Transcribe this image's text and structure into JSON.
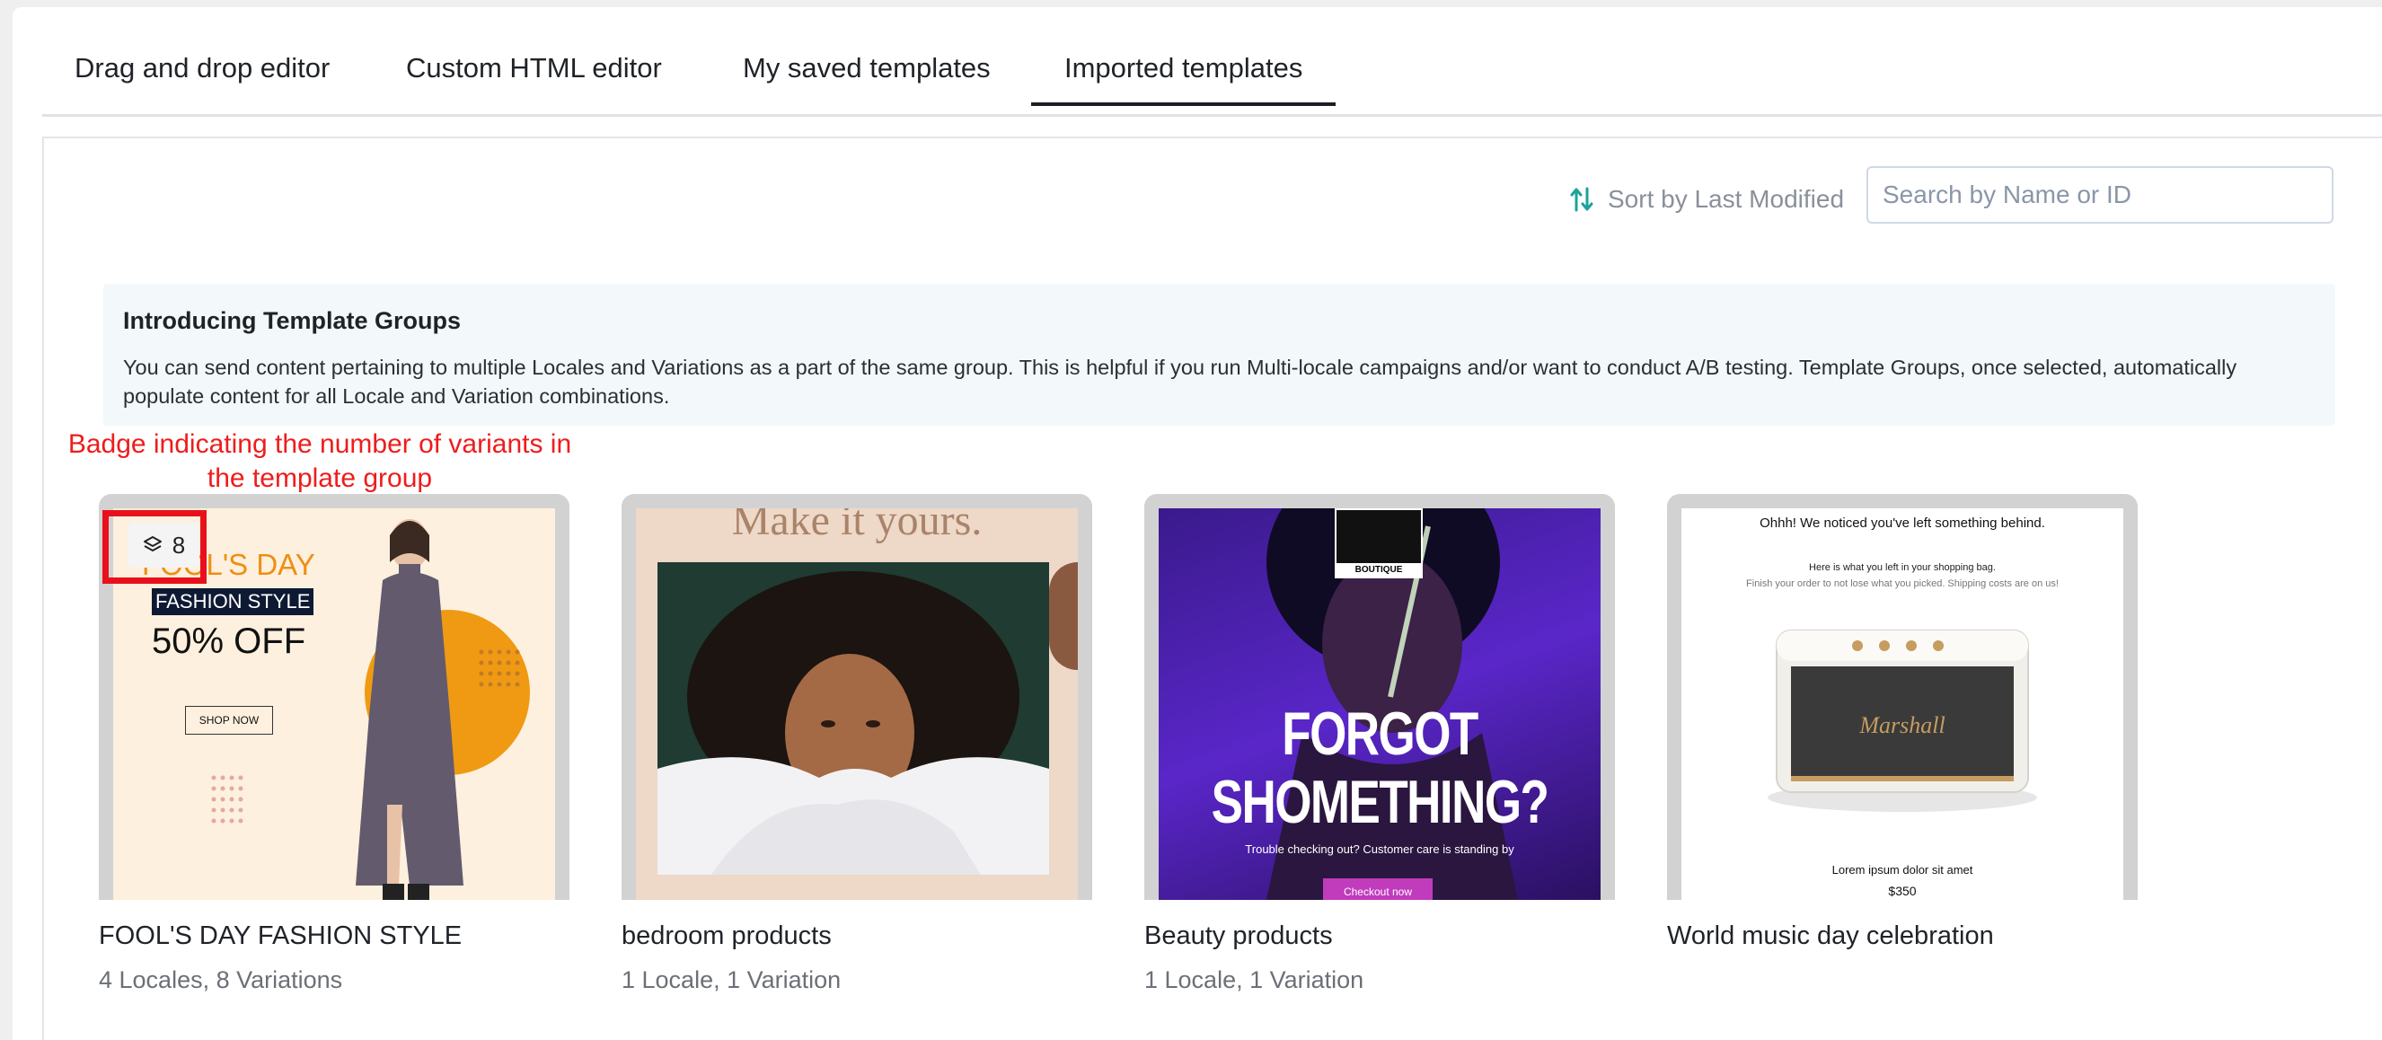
{
  "tabs": [
    {
      "label": "Drag and drop editor",
      "active": false
    },
    {
      "label": "Custom HTML editor",
      "active": false
    },
    {
      "label": "My saved templates",
      "active": false
    },
    {
      "label": "Imported templates",
      "active": true
    }
  ],
  "toolbar": {
    "sort_label": "Sort by Last Modified",
    "search_placeholder": "Search by Name or ID",
    "search_value": ""
  },
  "info_banner": {
    "title": "Introducing Template Groups",
    "body": "You can send content pertaining to multiple Locales and Variations as a part of the same group. This is helpful if you run Multi-locale campaigns and/or want to conduct A/B testing. Template Groups, once selected, automatically populate content for all Locale and Variation combinations."
  },
  "annotation": {
    "text_line1": "Badge indicating the number of variants in",
    "text_line2": "the template group",
    "color": "#ee1c1c"
  },
  "templates": [
    {
      "name": "FOOL'S DAY FASHION STYLE",
      "meta": "4 Locales, 8 Variations",
      "variant_badge": "8",
      "thumb": {
        "headline": "FOOL'S DAY",
        "tag": "FASHION STYLE",
        "offer": "50% OFF",
        "cta": "SHOP NOW"
      }
    },
    {
      "name": "bedroom products",
      "meta": "1 Locale, 1 Variation",
      "thumb": {
        "headline": "Make it yours."
      }
    },
    {
      "name": "Beauty products",
      "meta": "1 Locale, 1 Variation",
      "thumb": {
        "brand": "BOUTIQUE",
        "headline_line1": "FORGOT",
        "headline_line2": "SHOMETHING?",
        "subline": "Trouble checking out? Customer care is standing by",
        "cta": "Checkout now"
      }
    },
    {
      "name": "World music day celebration",
      "meta": "",
      "thumb": {
        "headline": "Ohhh! We noticed you've left something behind.",
        "line1": "Here is what you left in your shopping bag.",
        "line2": "Finish your order to not lose what you picked. Shipping costs are on us!",
        "product_brand": "Marshall",
        "caption": "Lorem ipsum dolor sit amet",
        "price": "$350"
      }
    }
  ],
  "colors": {
    "accent_teal": "#1aa39a",
    "active_tab_underline": "#1b1f24",
    "banner_bg": "#f3f8fb"
  }
}
